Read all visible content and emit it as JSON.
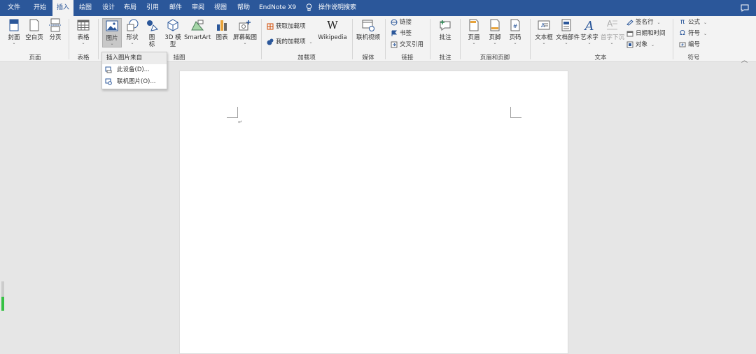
{
  "tabs": [
    "文件",
    "开始",
    "插入",
    "绘图",
    "设计",
    "布局",
    "引用",
    "邮件",
    "审阅",
    "视图",
    "帮助",
    "EndNote X9",
    "操作说明搜索"
  ],
  "active_tab": "插入",
  "ribbon": {
    "pages": {
      "cover": "封面",
      "blank": "空白页",
      "pagebreak": "分页",
      "group": "页面"
    },
    "tables": {
      "table": "表格",
      "group": "表格"
    },
    "illustrations": {
      "pictures": "图片",
      "shapes": "形状",
      "icons": "图\n标",
      "model3d": "3D 模\n型",
      "smartart": "SmartArt",
      "chart": "图表",
      "screenshot": "屏幕截图",
      "group": "插图"
    },
    "addins": {
      "get": "获取加载项",
      "mine": "我的加载项",
      "wikipedia": "Wikipedia",
      "group": "加载项"
    },
    "media": {
      "video": "联机视频",
      "group": "媒体"
    },
    "links": {
      "link": "链接",
      "bookmark": "书签",
      "crossref": "交叉引用",
      "group": "链接"
    },
    "comments": {
      "comment": "批注",
      "group": "批注"
    },
    "headerfooter": {
      "header": "页眉",
      "footer": "页脚",
      "pagenum": "页码",
      "group": "页眉和页脚"
    },
    "text": {
      "textbox": "文本框",
      "quickparts": "文档部件",
      "wordart": "艺术字",
      "dropcap": "首字下沉",
      "sigline": "签名行",
      "datetime": "日期和时间",
      "object": "对象",
      "group": "文本"
    },
    "symbols": {
      "equation": "公式",
      "symbol": "符号",
      "number": "编号",
      "group": "符号"
    }
  },
  "dropdown": {
    "header": "插入图片来自",
    "item1": "此设备(D)...",
    "item2": "联机图片(O)..."
  },
  "paragraph_mark": "↵",
  "colors": {
    "accent": "#2b579a",
    "ribbon_bg": "#f3f3f3",
    "canvas_bg": "#e6e6e6"
  }
}
